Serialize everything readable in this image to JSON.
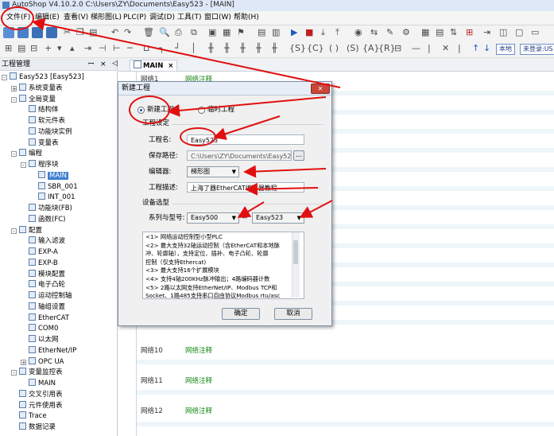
{
  "window": {
    "title": "AutoShop V4.10.2.0  C:\\Users\\ZY\\Documents\\Easy523 - [MAIN]"
  },
  "menu": [
    "文件(F)",
    "编辑(E)",
    "查看(V)",
    "梯形图(L)",
    "PLC(P)",
    "调试(D)",
    "工具(T)",
    "窗口(W)",
    "帮助(H)"
  ],
  "toolbar": {
    "local_label": "本地",
    "login_label": "未登录:US"
  },
  "project_panel": {
    "title": "工程管理",
    "pin": "ꟷ",
    "close": "×",
    "items": [
      {
        "label": "Easy523 [Easy523]",
        "level": 0,
        "expander": "-",
        "icon": "monitor-icon"
      },
      {
        "label": "系统变量表",
        "level": 1,
        "expander": "+",
        "icon": "table-icon"
      },
      {
        "label": "全局变量",
        "level": 1,
        "expander": "-",
        "icon": "table-icon"
      },
      {
        "label": "结构体",
        "level": 2,
        "expander": "",
        "icon": "struct-icon"
      },
      {
        "label": "软元件表",
        "level": 2,
        "expander": "",
        "icon": "table-icon"
      },
      {
        "label": "功能块实例",
        "level": 2,
        "expander": "",
        "icon": "fb-icon"
      },
      {
        "label": "变量表",
        "level": 2,
        "expander": "",
        "icon": "table-icon"
      },
      {
        "label": "编程",
        "level": 1,
        "expander": "-",
        "icon": "program-icon"
      },
      {
        "label": "程序块",
        "level": 2,
        "expander": "-",
        "icon": "block-icon"
      },
      {
        "label": "MAIN",
        "level": 3,
        "expander": "",
        "icon": "ladder-icon",
        "selected": true
      },
      {
        "label": "SBR_001",
        "level": 3,
        "expander": "",
        "icon": "ladder-icon"
      },
      {
        "label": "INT_001",
        "level": 3,
        "expander": "",
        "icon": "ladder-icon"
      },
      {
        "label": "功能块(FB)",
        "level": 2,
        "expander": "",
        "icon": "fb-icon"
      },
      {
        "label": "函数(FC)",
        "level": 2,
        "expander": "",
        "icon": "fc-icon"
      },
      {
        "label": "配置",
        "level": 1,
        "expander": "-",
        "icon": "config-icon"
      },
      {
        "label": "输入滤波",
        "level": 2,
        "expander": "",
        "icon": "filter-icon"
      },
      {
        "label": "EXP-A",
        "level": 2,
        "expander": "",
        "icon": "module-icon"
      },
      {
        "label": "EXP-B",
        "level": 2,
        "expander": "",
        "icon": "module-icon"
      },
      {
        "label": "模块配置",
        "level": 2,
        "expander": "",
        "icon": "module-icon"
      },
      {
        "label": "电子凸轮",
        "level": 2,
        "expander": "",
        "icon": "cam-icon"
      },
      {
        "label": "运动控制轴",
        "level": 2,
        "expander": "",
        "icon": "axis-icon"
      },
      {
        "label": "轴组设置",
        "level": 2,
        "expander": "",
        "icon": "axis-icon"
      },
      {
        "label": "EtherCAT",
        "level": 2,
        "expander": "",
        "icon": "network-icon"
      },
      {
        "label": "COM0",
        "level": 2,
        "expander": "",
        "icon": "gear-icon"
      },
      {
        "label": "以太网",
        "level": 2,
        "expander": "",
        "icon": "network-icon"
      },
      {
        "label": "EtherNet/IP",
        "level": 2,
        "expander": "",
        "icon": "network-icon"
      },
      {
        "label": "OPC UA",
        "level": 2,
        "expander": "+",
        "icon": "opc-icon"
      },
      {
        "label": "变量监控表",
        "level": 1,
        "expander": "-",
        "icon": "monitor-table-icon"
      },
      {
        "label": "MAIN",
        "level": 2,
        "expander": "",
        "icon": "table-icon"
      },
      {
        "label": "交叉引用表",
        "level": 1,
        "expander": "",
        "icon": "table-icon"
      },
      {
        "label": "元件使用表",
        "level": 1,
        "expander": "",
        "icon": "table-icon"
      },
      {
        "label": "Trace",
        "level": 1,
        "expander": "",
        "icon": "trace-icon"
      },
      {
        "label": "数据记录",
        "level": 1,
        "expander": "",
        "icon": "record-icon"
      }
    ]
  },
  "editor": {
    "tab_label": "MAIN",
    "tab_close": "×",
    "tab_nav": "◁",
    "networks": [
      {
        "label": "网络1",
        "comment": "网络注释"
      },
      {
        "label": "网络10",
        "comment": "网络注释"
      },
      {
        "label": "网络11",
        "comment": "网络注释"
      },
      {
        "label": "网络12",
        "comment": "网络注释"
      }
    ]
  },
  "dialog": {
    "title": "新建工程",
    "close": "✕",
    "radio_new": "新建工程",
    "radio_temp": "临时工程",
    "section_project": "工程设定",
    "name_label": "工程名:",
    "name_value": "Easy523",
    "path_label": "保存路径:",
    "path_value": "C:\\Users\\ZY\\Documents\\Easy523\\",
    "browse": "...",
    "editor_label": "编辑器:",
    "editor_value": "梯形图",
    "desc_label": "工程描述:",
    "desc_value": "上海了器EtherCAT编码器教程",
    "section_device": "设备选型",
    "series_label": "系列与型号:",
    "series_value": "Easy500",
    "separator": "--",
    "model_value": "Easy523",
    "description_lines": [
      "<1> 网络运动控制型小型PLC",
      "<2> 最大支持32轴运动控制（含EtherCAT和本地脉",
      "冲、轮廓轴），支持定位、插补、电子凸轮、轮廓",
      "控制（仅支持Ethercat)",
      "<3> 最大支持16个扩展模块",
      "<4> 支持4轴200KHz脉冲输出；4路编码器计数",
      "<5> 2路以太网支持EtherNet/IP、Modbus TCP和",
      "Socket、1路485支持串口自由协议Modbus rtu/asc"
    ],
    "ok": "确定",
    "cancel": "取消"
  },
  "colors": {
    "annotation_red": "#e01010",
    "comment_green": "#1a8a1a",
    "selection_blue": "#3f7fd0"
  }
}
